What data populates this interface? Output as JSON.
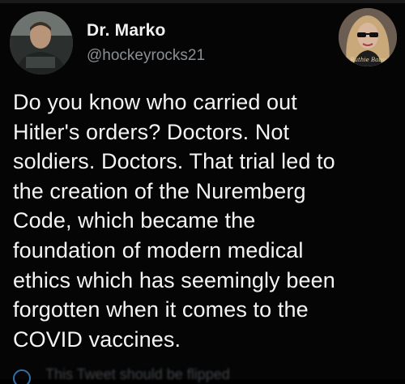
{
  "tweet": {
    "author": {
      "display_name": "Dr. Marko",
      "handle": "@hockeyrocks21"
    },
    "sticker_caption": "Ruthie Baby",
    "text": "Do you know who carried out\nHitler's orders? Doctors. Not\nsoldiers. Doctors. That trial led to\nthe creation of the Nuremberg\nCode, which became the\nfoundation of modern medical\nethics which has seemingly been\nforgotten when it comes to the\nCOVID vaccines.",
    "bottom_partial": "This Tweet should be flipped"
  },
  "colors": {
    "background": "#050505",
    "primary_text": "#f4f4f4",
    "secondary_text": "#8b9095",
    "accent": "#2f6fa6"
  },
  "icons": {
    "bottom": "info-circle-icon"
  }
}
